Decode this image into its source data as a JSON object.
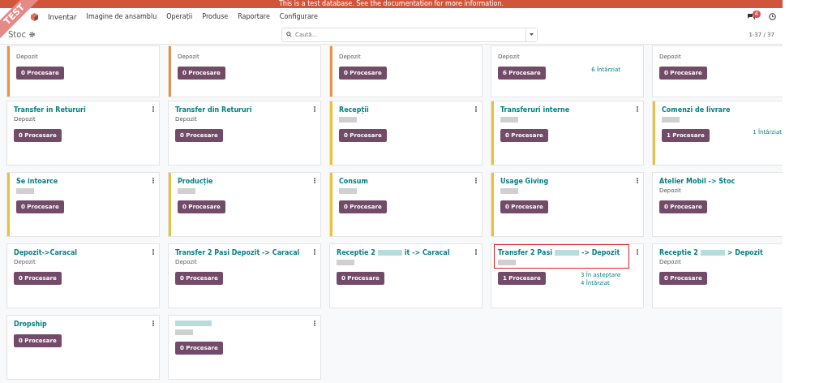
{
  "banner": "This is a test database. See the documentation for more information.",
  "ribbon": "TEST",
  "nav": {
    "app": "Inventar",
    "menu": [
      "Imagine de ansamblu",
      "Operații",
      "Produse",
      "Raportare",
      "Configurare"
    ],
    "messages_badge": "4"
  },
  "control_panel": {
    "breadcrumb": "Stoc",
    "search_placeholder": "Caută...",
    "pager": "1-37 / 37"
  },
  "cards": [
    {
      "subtitle": "Depozit",
      "button": "0 Procesare",
      "color": "#e8924a"
    },
    {
      "subtitle": "Depozit",
      "button": "0 Procesare",
      "color": "#e8924a"
    },
    {
      "subtitle": "Depozit",
      "button": "0 Procesare",
      "color": "#e8924a"
    },
    {
      "subtitle": "Depozit",
      "button": "6 Procesare",
      "stats": [
        "6 Întârziat"
      ]
    },
    {
      "subtitle": "Depozit",
      "button": "0 Procesare"
    },
    {
      "title": "Transfer in Retururi",
      "subtitle": "Depozit",
      "button": "0 Procesare",
      "menu": true
    },
    {
      "title": "Transfer din Retururi",
      "subtitle": "Depozit",
      "button": "0 Procesare",
      "menu": true
    },
    {
      "title": "Recepții",
      "subtitle_redacted": true,
      "button": "0 Procesare",
      "menu": true,
      "color": "#e9c13b"
    },
    {
      "title": "Transferuri interne",
      "subtitle_redacted": true,
      "button": "0 Procesare",
      "menu": true,
      "color": "#e9c13b"
    },
    {
      "title": "Comenzi de livrare",
      "subtitle_redacted": true,
      "button": "1 Procesare",
      "stats": [
        "1 Întârziat"
      ],
      "color": "#e9c13b"
    },
    {
      "title": "Se intoarce",
      "subtitle_redacted": true,
      "button": "0 Procesare",
      "menu": true,
      "color": "#e9c13b"
    },
    {
      "title": "Producție",
      "subtitle_redacted": true,
      "button": "0 Procesare",
      "menu": true,
      "color": "#e9c13b"
    },
    {
      "title": "Consum",
      "subtitle_redacted": true,
      "button": "0 Procesare",
      "menu": true,
      "color": "#e9c13b"
    },
    {
      "title": "Usage Giving",
      "subtitle_redacted": true,
      "button": "0 Procesare",
      "menu": true,
      "color": "#e9c13b"
    },
    {
      "title": "Atelier Mobil -> Stoc",
      "subtitle": "Depozit",
      "button": "0 Procesare"
    },
    {
      "title": "Depozit->Caracal",
      "subtitle": "Depozit",
      "button": "0 Procesare",
      "menu": true
    },
    {
      "title": "Transfer 2 Pasi Depozit -> Caracal",
      "subtitle": "Depozit",
      "button": "0 Procesare",
      "menu": true
    },
    {
      "title": "Receptie 2",
      "title_redacted": true,
      "title_tail": "it -> Caracal",
      "subtitle_redacted": true,
      "button": "0 Procesare",
      "menu": true
    },
    {
      "title": "Transfer 2 Pasi",
      "title_redacted": true,
      "title_tail": "-> Depozit",
      "subtitle_redacted": true,
      "button": "1 Procesare",
      "stats": [
        "3 În așteptare",
        "4 Întârziat"
      ],
      "menu": true,
      "highlighted": true
    },
    {
      "title": "Receptie 2",
      "title_redacted": true,
      "title_tail": "> Depozit",
      "subtitle": "Depozit",
      "button": "0 Procesare"
    },
    {
      "title": "Dropship",
      "button": "0 Procesare",
      "menu": true
    },
    {
      "title_redacted": true,
      "subtitle_redacted": true,
      "button": "0 Procesare",
      "menu": true
    }
  ]
}
